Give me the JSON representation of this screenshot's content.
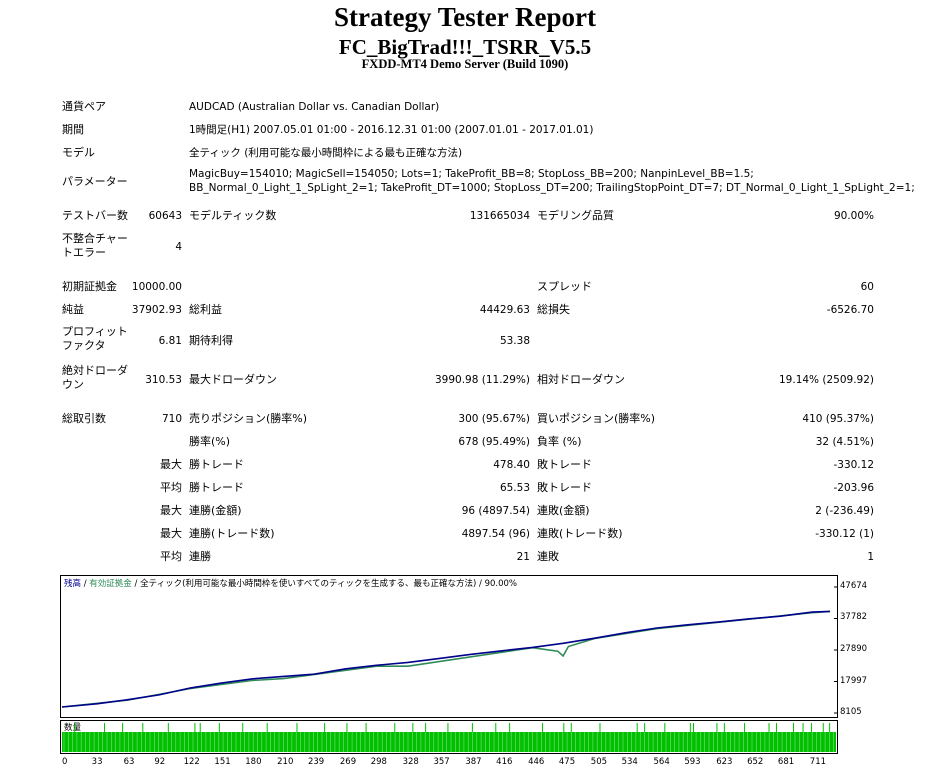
{
  "header": {
    "title": "Strategy Tester Report",
    "ea_name": "FC_BigTrad!!!_TSRR_V5.5",
    "server": "FXDD-MT4 Demo Server (Build 1090)"
  },
  "info": {
    "symbol_label": "通貨ペア",
    "symbol_value": "AUDCAD (Australian Dollar vs. Canadian Dollar)",
    "period_label": "期間",
    "period_value": "1時間足(H1) 2007.05.01 01:00 - 2016.12.31 01:00 (2007.01.01 - 2017.01.01)",
    "model_label": "モデル",
    "model_value": "全ティック (利用可能な最小時間枠による最も正確な方法)",
    "params_label": "パラメーター",
    "params_line1": "MagicBuy=154010; MagicSell=154050; Lots=1; TakeProfit_BB=8; StopLoss_BB=200; NanpinLevel_BB=1.5;",
    "params_line2": "BB_Normal_0_Light_1_SpLight_2=1; TakeProfit_DT=1000; StopLoss_DT=200; TrailingStopPoint_DT=7; DT_Normal_0_Light_1_SpLight_2=1;"
  },
  "stats": {
    "bars_label": "テストバー数",
    "bars_value": "60643",
    "ticks_label": "モデルティック数",
    "ticks_value": "131665034",
    "quality_label": "モデリング品質",
    "quality_value": "90.00%",
    "mismatch_label": "不整合チャートエラー",
    "mismatch_value": "4",
    "deposit_label": "初期証拠金",
    "deposit_value": "10000.00",
    "spread_label": "スプレッド",
    "spread_value": "60",
    "net_label": "純益",
    "net_value": "37902.93",
    "gross_profit_label": "総利益",
    "gross_profit_value": "44429.63",
    "gross_loss_label": "総損失",
    "gross_loss_value": "-6526.70",
    "pf_label": "プロフィットファクタ",
    "pf_value": "6.81",
    "expected_label": "期待利得",
    "expected_value": "53.38",
    "abs_dd_label": "絶対ドローダウン",
    "abs_dd_value": "310.53",
    "max_dd_label": "最大ドローダウン",
    "max_dd_value": "3990.98 (11.29%)",
    "rel_dd_label": "相対ドローダウン",
    "rel_dd_value": "19.14% (2509.92)",
    "total_trades_label": "総取引数",
    "total_trades_value": "710",
    "short_label": "売りポジション(勝率%)",
    "short_value": "300 (95.67%)",
    "long_label": "買いポジション(勝率%)",
    "long_value": "410 (95.37%)",
    "win_rate_label": "勝率(%)",
    "win_rate_value": "678 (95.49%)",
    "loss_rate_label": "負率 (%)",
    "loss_rate_value": "32 (4.51%)",
    "largest_label": "最大",
    "largest_win_label": "勝トレード",
    "largest_win_value": "478.40",
    "largest_loss_label": "敗トレード",
    "largest_loss_value": "-330.12",
    "average_label": "平均",
    "avg_win_label": "勝トレード",
    "avg_win_value": "65.53",
    "avg_loss_label": "敗トレード",
    "avg_loss_value": "-203.96",
    "max1_label": "最大",
    "max_cons_wins_label": "連勝(金額)",
    "max_cons_wins_value": "96 (4897.54)",
    "max_cons_losses_label": "連敗(金額)",
    "max_cons_losses_value": "2 (-236.49)",
    "max2_label": "最大",
    "max_cons_profit_label": "連勝(トレード数)",
    "max_cons_profit_value": "4897.54 (96)",
    "max_cons_loss_label": "連敗(トレード数)",
    "max_cons_loss_value": "-330.12 (1)",
    "avg2_label": "平均",
    "avg_cons_wins_label": "連勝",
    "avg_cons_wins_value": "21",
    "avg_cons_losses_label": "連敗",
    "avg_cons_losses_value": "1"
  },
  "chart_data": {
    "type": "line",
    "legend_balance": "残高",
    "legend_equity": "有効証拠金",
    "legend_info": "全ティック(利用可能な最小時間枠を使いすべてのティックを生成する、最も正確な方法)",
    "legend_quality": "90.00%",
    "colors": {
      "balance": "#00008b",
      "equity": "#2e8b57",
      "volume": "#00c000"
    },
    "ylim": [
      8105,
      47674
    ],
    "xlim": [
      0,
      728
    ],
    "y_ticks": [
      "47674",
      "37782",
      "27890",
      "17997",
      "8105"
    ],
    "y_tick_values": [
      47674,
      37782,
      27890,
      17997,
      8105
    ],
    "x_ticks": [
      "0",
      "33",
      "63",
      "92",
      "122",
      "151",
      "180",
      "210",
      "239",
      "269",
      "298",
      "328",
      "357",
      "387",
      "416",
      "446",
      "475",
      "505",
      "534",
      "564",
      "593",
      "623",
      "652",
      "681",
      "711"
    ],
    "x_tick_values": [
      0,
      33,
      63,
      92,
      122,
      151,
      180,
      210,
      239,
      269,
      298,
      328,
      357,
      387,
      416,
      446,
      475,
      505,
      534,
      564,
      593,
      623,
      652,
      681,
      711
    ],
    "series": [
      {
        "name": "残高",
        "x": [
          0,
          33,
          63,
          92,
          122,
          151,
          180,
          210,
          239,
          269,
          298,
          328,
          357,
          387,
          416,
          446,
          475,
          505,
          534,
          564,
          593,
          623,
          652,
          681,
          711,
          728
        ],
        "y": [
          10000,
          11000,
          12300,
          13800,
          16000,
          17500,
          18800,
          19600,
          20300,
          22000,
          23100,
          24000,
          25200,
          26500,
          27600,
          28700,
          30000,
          31600,
          33300,
          34800,
          35800,
          36700,
          37700,
          38500,
          39800,
          40000
        ]
      },
      {
        "name": "有効証拠金",
        "x": [
          0,
          63,
          122,
          180,
          210,
          298,
          328,
          446,
          470,
          475,
          480,
          505,
          564,
          652,
          711,
          728
        ],
        "y": [
          10000,
          12200,
          15800,
          18300,
          18900,
          22800,
          22800,
          28600,
          27500,
          26000,
          29000,
          31500,
          34600,
          37600,
          39600,
          40000
        ]
      }
    ],
    "volume_label": "数量",
    "volume_spikes_x": [
      12,
      40,
      57,
      76,
      100,
      125,
      130,
      148,
      170,
      193,
      221,
      247,
      268,
      286,
      313,
      330,
      342,
      363,
      386,
      408,
      421,
      452,
      472,
      479,
      506,
      541,
      548,
      567,
      591,
      594,
      616,
      623,
      642,
      665,
      672,
      688,
      697,
      705,
      716,
      722
    ]
  }
}
